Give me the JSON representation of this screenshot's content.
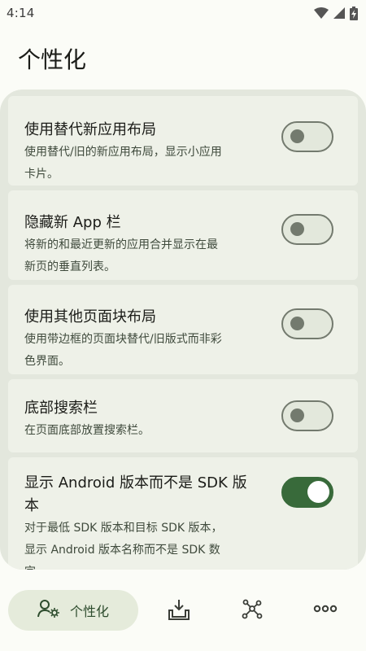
{
  "status_bar": {
    "time": "4:14"
  },
  "page": {
    "title": "个性化"
  },
  "settings": [
    {
      "title": "使用替代新应用布局",
      "description_lines": [
        "使用替代/旧的新应用布局，显示小应用",
        "卡片。"
      ],
      "enabled": false
    },
    {
      "title": "隐藏新 App 栏",
      "description_lines": [
        "将新的和最近更新的应用合并显示在最",
        "新页的垂直列表。"
      ],
      "enabled": false
    },
    {
      "title": "使用其他页面块布局",
      "description_lines": [
        "使用带边框的页面块替代/旧版式而非彩",
        "色界面。"
      ],
      "enabled": false
    },
    {
      "title": "底部搜索栏",
      "description_lines": [
        "在页面底部放置搜索栏。"
      ],
      "enabled": false
    },
    {
      "title_lines": [
        "显示 Android 版本而不是 SDK 版",
        "本"
      ],
      "description_lines": [
        "对于最低 SDK 版本和目标 SDK 版本，",
        "显示 Android 版本名称而不是 SDK 数",
        "字。"
      ],
      "enabled": true
    }
  ],
  "bottom_nav": {
    "active_label": "个性化",
    "items": [
      "personalization-icon",
      "download-icon",
      "graph-nodes-icon",
      "more-dots-icon"
    ]
  },
  "colors": {
    "accent": "#386a3a",
    "panel": "#e3e7dd",
    "card": "#eef1e8",
    "background": "#fbfcf7"
  }
}
